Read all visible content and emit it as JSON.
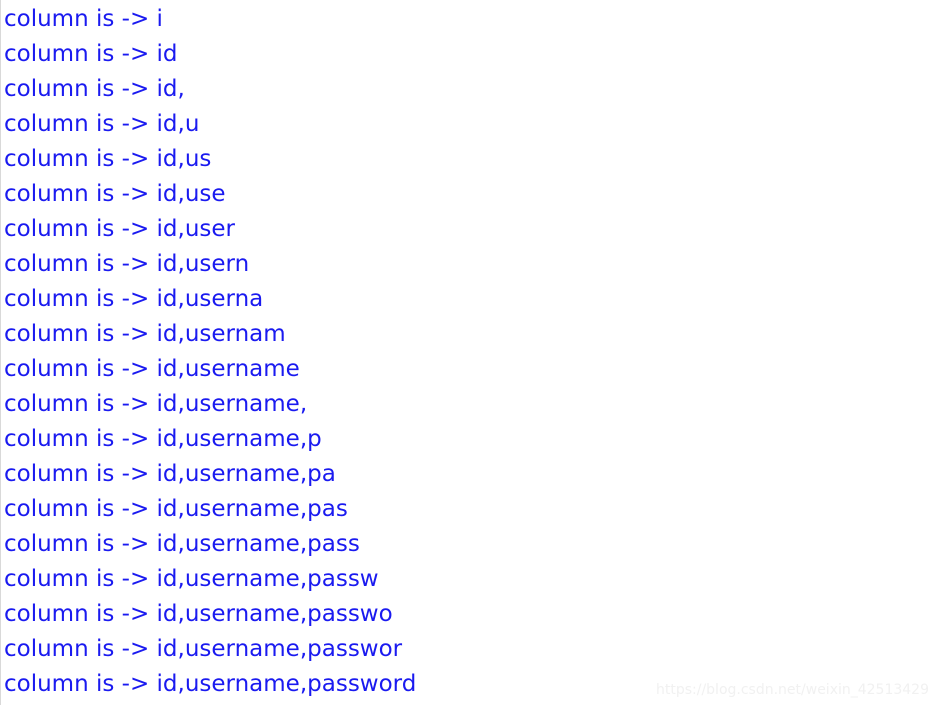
{
  "window": {
    "background_color": "#ffffff",
    "text_color": "#1a1af0",
    "edge_rule_color": "#d9d9d9"
  },
  "console": {
    "name": "console-output",
    "line_count": 20,
    "prefix": "column is -> ",
    "lines": [
      "column is -> i",
      "column is -> id",
      "column is -> id,",
      "column is -> id,u",
      "column is -> id,us",
      "column is -> id,use",
      "column is -> id,user",
      "column is -> id,usern",
      "column is -> id,userna",
      "column is -> id,usernam",
      "column is -> id,username",
      "column is -> id,username,",
      "column is -> id,username,p",
      "column is -> id,username,pa",
      "column is -> id,username,pas",
      "column is -> id,username,pass",
      "column is -> id,username,passw",
      "column is -> id,username,passwo",
      "column is -> id,username,passwor",
      "column is -> id,username,password"
    ]
  },
  "watermark": {
    "text": "https://blog.csdn.net/weixin_42513429",
    "color": "#f1f1f1"
  }
}
